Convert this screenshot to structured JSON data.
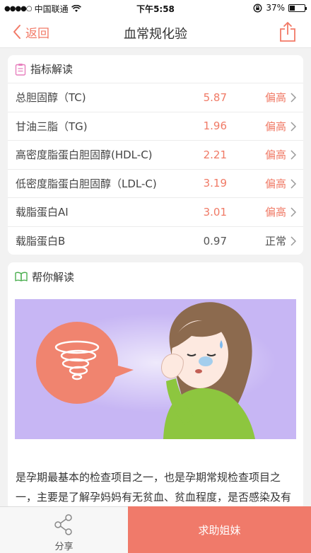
{
  "status_bar": {
    "carrier": "中国联通",
    "time": "下午5:58",
    "battery_percent": "37%",
    "battery_level": 0.37
  },
  "nav": {
    "back_label": "返回",
    "title": "血常规化验"
  },
  "indicators": {
    "title": "指标解读",
    "rows": [
      {
        "name": "总胆固醇（TC)",
        "value": "5.87",
        "status": "偏高",
        "level": "high"
      },
      {
        "name": "甘油三脂（TG)",
        "value": "1.96",
        "status": "偏高",
        "level": "high"
      },
      {
        "name": "高密度脂蛋白胆固醇(HDL-C)",
        "value": "2.21",
        "status": "偏高",
        "level": "high"
      },
      {
        "name": "低密度脂蛋白胆固醇（LDL-C)",
        "value": "3.19",
        "status": "偏高",
        "level": "high"
      },
      {
        "name": "载脂蛋白AI",
        "value": "3.01",
        "status": "偏高",
        "level": "high"
      },
      {
        "name": "载脂蛋白B",
        "value": "0.97",
        "status": "正常",
        "level": "normal"
      }
    ]
  },
  "help": {
    "title": "帮你解读",
    "description": "是孕期最基本的检查项目之一，也是孕期常规检查项目之一，主要是了解孕妈妈有无贫血、贫血程度，是否感染及有"
  },
  "bottom": {
    "share_label": "分享",
    "help_label": "求助姐妹"
  },
  "colors": {
    "accent": "#f07a66",
    "illustration_bg": "#c7b6f4"
  }
}
